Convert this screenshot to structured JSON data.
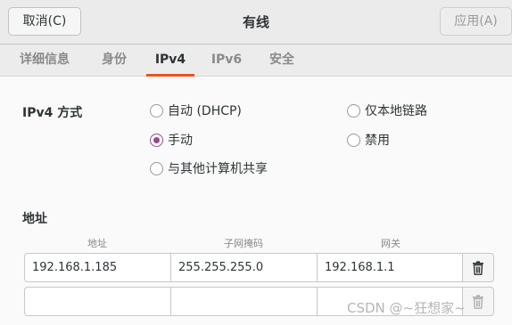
{
  "header": {
    "title": "有线",
    "cancel_label": "取消(C)",
    "apply_label": "应用(A)"
  },
  "tabs": [
    {
      "label": "详细信息",
      "active": false
    },
    {
      "label": "身份",
      "active": false
    },
    {
      "label": "IPv4",
      "active": true
    },
    {
      "label": "IPv6",
      "active": false
    },
    {
      "label": "安全",
      "active": false
    }
  ],
  "ipv4": {
    "method_label": "IPv4 方式",
    "options": [
      {
        "label": "自动 (DHCP)",
        "checked": false
      },
      {
        "label": "仅本地链路",
        "checked": false
      },
      {
        "label": "手动",
        "checked": true
      },
      {
        "label": "禁用",
        "checked": false
      },
      {
        "label": "与其他计算机共享",
        "checked": false
      }
    ]
  },
  "addresses": {
    "section_label": "地址",
    "columns": [
      "地址",
      "子网掩码",
      "网关"
    ],
    "rows": [
      {
        "address": "192.168.1.185",
        "netmask": "255.255.255.0",
        "gateway": "192.168.1.1"
      },
      {
        "address": "",
        "netmask": "",
        "gateway": ""
      }
    ]
  },
  "icons": {
    "delete": "trash-icon"
  },
  "colors": {
    "accent_tab": "#e95420",
    "radio_checked": "#924d8b"
  },
  "watermark": "CSDN @~狂想家~"
}
